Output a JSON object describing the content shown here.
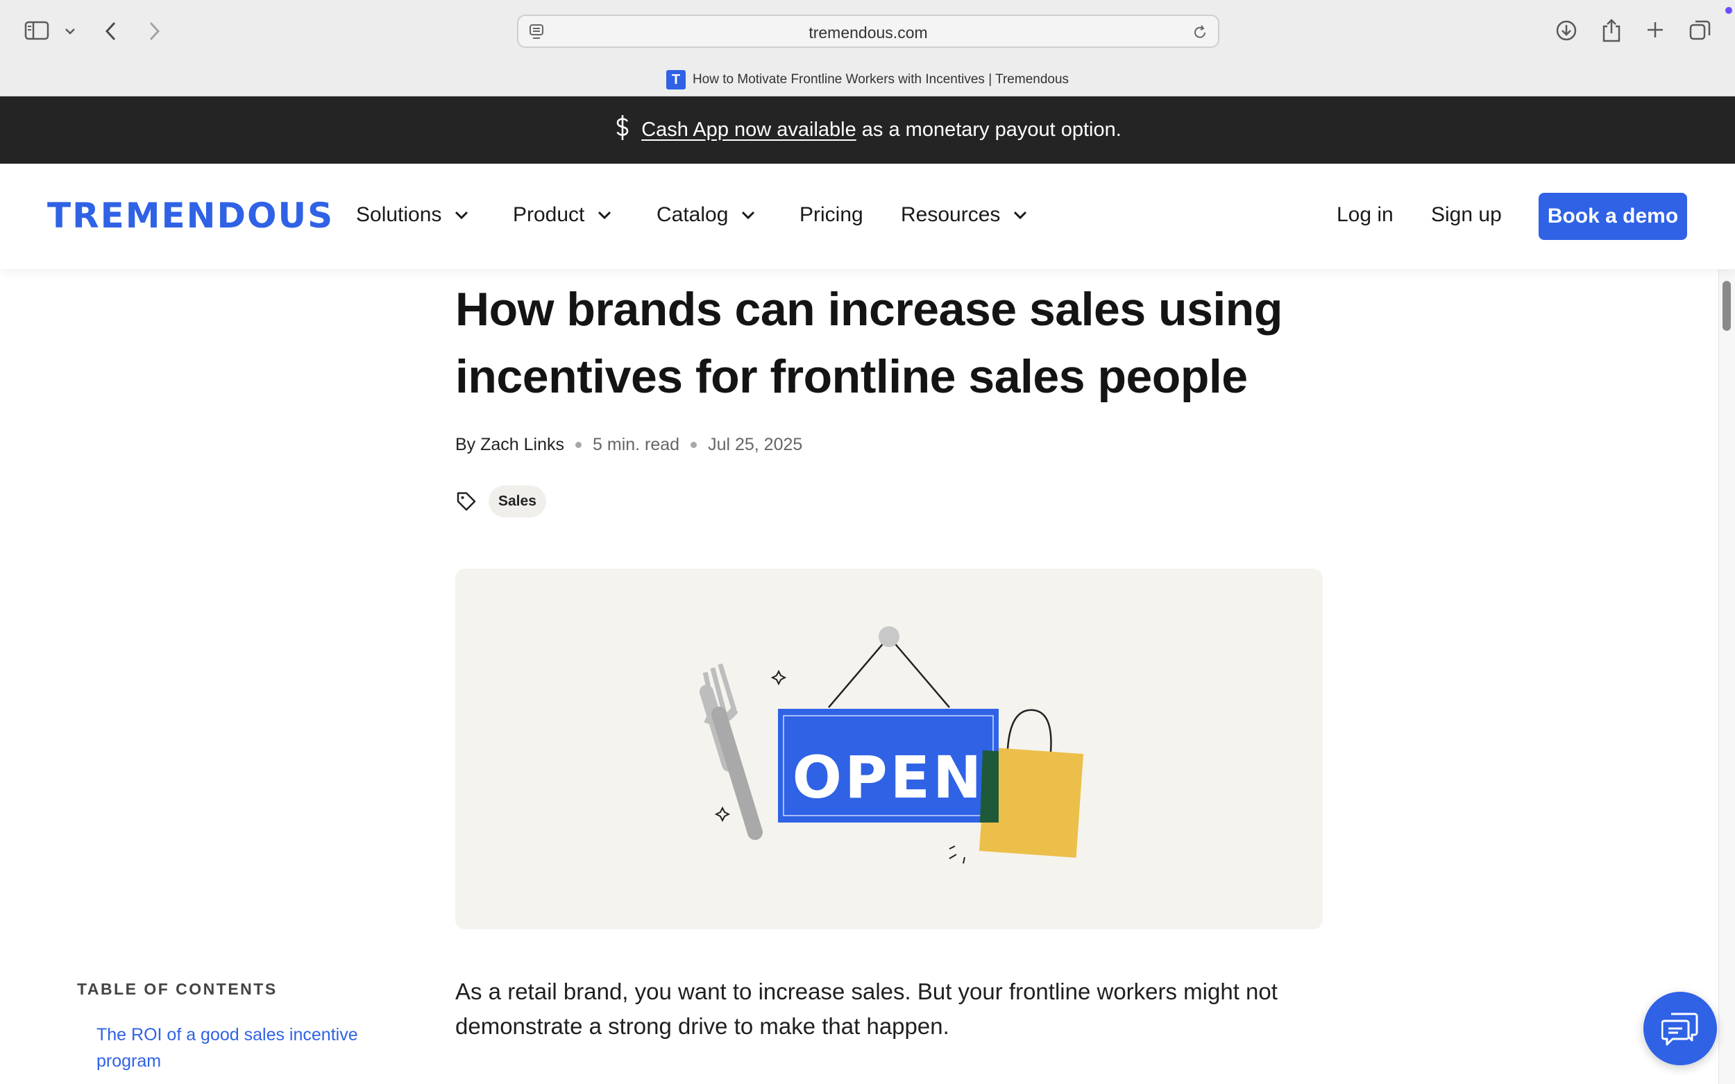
{
  "browser": {
    "url": "tremendous.com",
    "tab_title": "How to Motivate Frontline Workers with Incentives | Tremendous",
    "favicon_letter": "T",
    "icons": [
      "sidebar-icon",
      "chevron-down-icon",
      "back-icon",
      "forward-icon",
      "page-icon",
      "reload-icon",
      "download-icon",
      "share-icon",
      "plus-icon",
      "tabs-icon"
    ]
  },
  "announcement": {
    "link_text": "Cash App now available",
    "rest_text": "as a monetary payout option.",
    "icon": "dollar-icon"
  },
  "nav": {
    "logo": "TREMENDOUS",
    "items": [
      {
        "label": "Solutions"
      },
      {
        "label": "Product"
      },
      {
        "label": "Catalog"
      },
      {
        "label": "Pricing"
      },
      {
        "label": "Resources"
      }
    ],
    "login": "Log in",
    "signup": "Sign up",
    "cta": "Book a demo",
    "brand_color": "#2f62e5"
  },
  "article": {
    "title": "How brands can increase sales using incentives for frontline sales people",
    "author": "By Zach Links",
    "read_time": "5 min. read",
    "date": "Jul 25, 2025",
    "tag": "Sales",
    "hero_sign_text": "OPEN",
    "lead": "As a retail brand, you want to increase sales. But your frontline workers might not demonstrate a strong drive to make that happen."
  },
  "toc": {
    "heading": "TABLE OF CONTENTS",
    "items": [
      "The ROI of a good sales incentive program"
    ]
  },
  "chat": {
    "icon": "chat-bubbles-icon"
  }
}
